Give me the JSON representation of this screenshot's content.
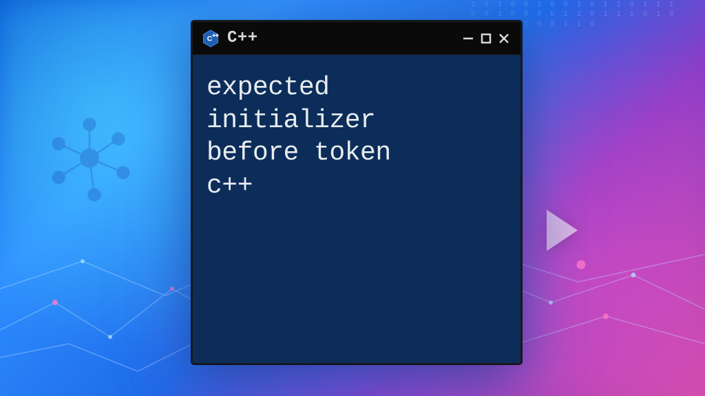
{
  "window": {
    "title": "C++",
    "content_line1": "expected",
    "content_line2": "initializer",
    "content_line3": "before token",
    "content_line4": "c++"
  },
  "icons": {
    "app": "cpp-hexagon-icon",
    "minimize": "minimize-icon",
    "maximize": "maximize-icon",
    "close": "close-icon"
  },
  "background": {
    "binary_sample": "1 0 1 0 0 1 0\n0 1 0 1 1 0 1\n1 1 0 0 1 0 0\n0 0 1 1 0 1 1\n1 0 1 0 1 0 1\n0 1 0 0 1 1 0"
  }
}
